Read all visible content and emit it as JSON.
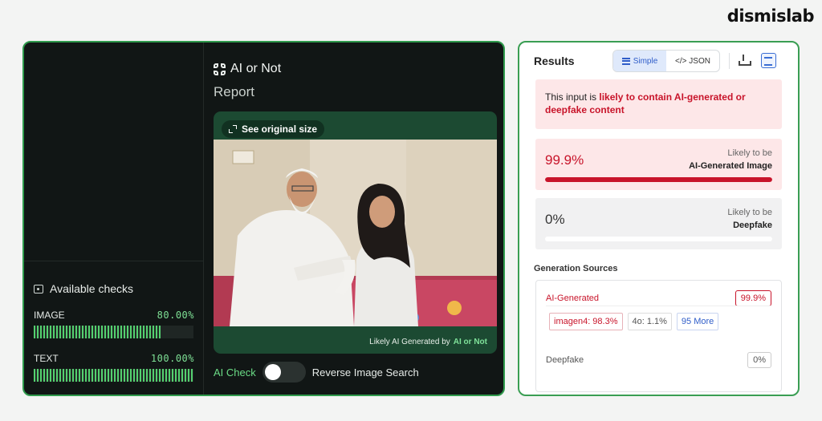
{
  "brand": "dismislab",
  "left_app": {
    "title": "AI or Not",
    "report_label": "Report",
    "see_original": "See original size",
    "watermark_prefix": "Likely AI Generated by",
    "watermark_brand": "AI or Not",
    "toggle_left": "AI Check",
    "toggle_right": "Reverse Image Search",
    "checks_title": "Available checks",
    "checks": [
      {
        "label": "IMAGE",
        "pct": "80.00%",
        "value": 0.8
      },
      {
        "label": "TEXT",
        "pct": "100.00%",
        "value": 1.0
      }
    ]
  },
  "results": {
    "title": "Results",
    "tabs": [
      {
        "label": "Simple"
      },
      {
        "label": "</> JSON"
      }
    ],
    "alert_prefix": "This input is ",
    "alert_highlight": "likely to contain AI-generated or deepfake content",
    "ai_score": {
      "value": "99.9%",
      "label1": "Likely to be",
      "label2": "AI-Generated Image",
      "fill": 0.999
    },
    "deepfake_score": {
      "value": "0%",
      "label1": "Likely to be",
      "label2": "Deepfake",
      "fill": 0
    },
    "sources_title": "Generation Sources",
    "ai_generated": {
      "label": "AI-Generated",
      "value": "99.9%"
    },
    "tags": [
      "imagen4: 98.3%",
      "4o: 1.1%",
      "95 More"
    ],
    "deepfake": {
      "label": "Deepfake",
      "value": "0%"
    }
  },
  "colors": {
    "accent_green": "#54d06f",
    "alert_red": "#c8142a",
    "link_blue": "#2f5dc9"
  }
}
